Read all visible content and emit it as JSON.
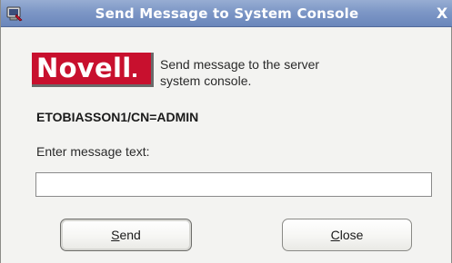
{
  "window": {
    "title": "Send Message to System Console",
    "close_glyph": "X",
    "icon": "console-app-icon"
  },
  "logo": {
    "text": "Novell"
  },
  "description": {
    "line1": "Send message to the server",
    "line2": "system console."
  },
  "server_name": "ETOBIASSON1/CN=ADMIN",
  "message": {
    "label": "Enter message text:",
    "value": "",
    "placeholder": ""
  },
  "buttons": {
    "send": {
      "mnemonic": "S",
      "rest": "end"
    },
    "close": {
      "mnemonic": "C",
      "rest": "lose"
    }
  },
  "colors": {
    "titlebar": "#7d97c6",
    "logo_red": "#c8102e",
    "background": "#f3f3f1"
  }
}
